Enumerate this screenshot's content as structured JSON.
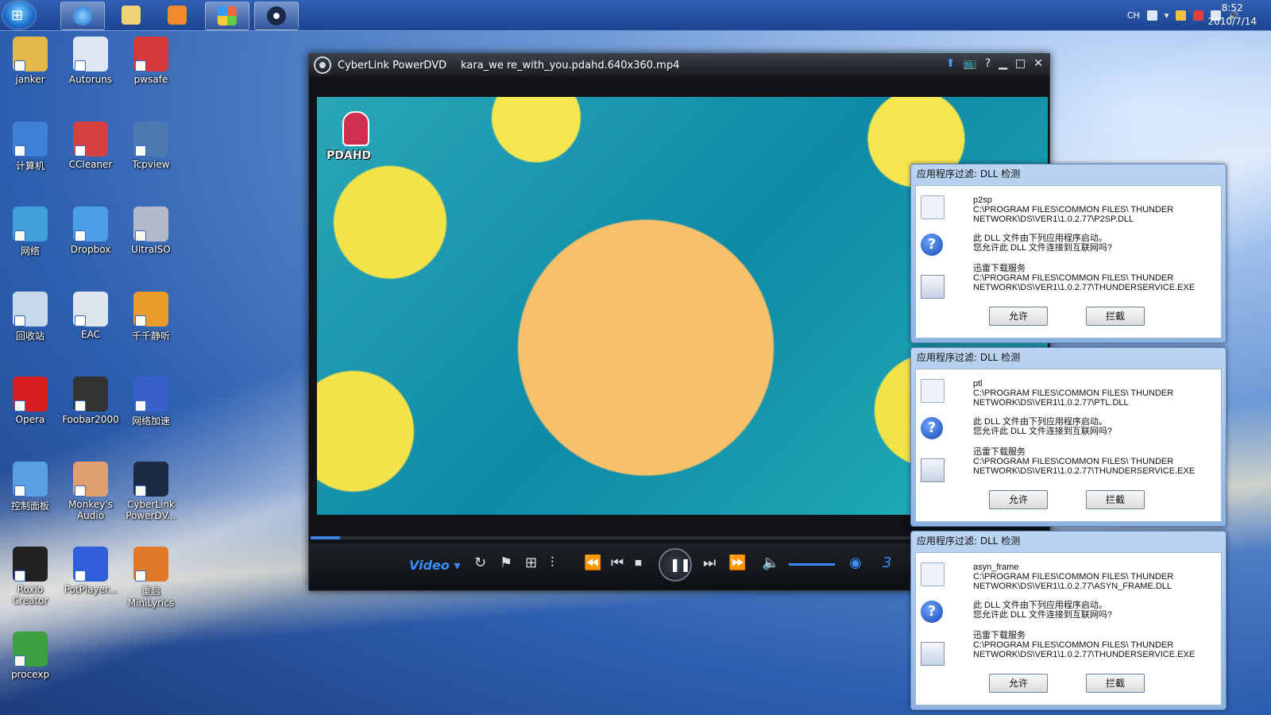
{
  "taskbar": {
    "apps": [
      "Internet Explorer",
      "Windows Explorer",
      "Media Player",
      "Windows Live",
      "CyberLink PowerDVD"
    ],
    "tray": {
      "lang": "CH"
    },
    "clock": {
      "time": "8:52",
      "date": "2010/7/14"
    }
  },
  "desktop": {
    "icons": [
      {
        "label": "janker",
        "color": "#e3b84a"
      },
      {
        "label": "Autoruns",
        "color": "#dfe6f2"
      },
      {
        "label": "pwsafe",
        "color": "#d63a3a"
      },
      {
        "label": "计算机",
        "color": "#3f7fd6"
      },
      {
        "label": "CCleaner",
        "color": "#d84040"
      },
      {
        "label": "Tcpview",
        "color": "#4c7ab0"
      },
      {
        "label": "网络",
        "color": "#3fa0d8"
      },
      {
        "label": "Dropbox",
        "color": "#4da0e8"
      },
      {
        "label": "UltraISO",
        "color": "#b3b9c8"
      },
      {
        "label": "回收站",
        "color": "#c8d8ea"
      },
      {
        "label": "EAC",
        "color": "#dfe5ee"
      },
      {
        "label": "千千静听",
        "color": "#e89a2a"
      },
      {
        "label": "Opera",
        "color": "#d81e1e"
      },
      {
        "label": "Foobar2000",
        "color": "#333333"
      },
      {
        "label": "网络加速",
        "color": "#3860c8"
      },
      {
        "label": "控制面板",
        "color": "#5aa0e0"
      },
      {
        "label": "Monkey's Audio",
        "color": "#e0a070"
      },
      {
        "label": "CyberLink PowerDV...",
        "color": "#1d2a45"
      },
      {
        "label": "Roxio Creator",
        "color": "#222222"
      },
      {
        "label": "PotPlayer...",
        "color": "#2f5ed8"
      },
      {
        "label": "重启 MiniLyrics",
        "color": "#e07a2a"
      },
      {
        "label": "procexp",
        "color": "#3ca040"
      }
    ]
  },
  "player": {
    "app_name": "CyberLink PowerDVD",
    "file_name": "kara_we re_with_you.pdahd.640x360.mp4",
    "watermark": "PDAHD",
    "mode_label": "Video",
    "seek_progress": 0.04,
    "volume_level": 0.6,
    "truncated_counter": "3"
  },
  "dialogs": [
    {
      "title": "应用程序过滤: DLL 检测",
      "dll_name": "p2sp",
      "dll_path_1": "C:\\PROGRAM FILES\\COMMON FILES\\ THUNDER",
      "dll_path_2": "NETWORK\\DS\\VER1\\1.0.2.77\\P2SP.DLL",
      "question_1": "此 DLL 文件由下列应用程序启动。",
      "question_2": "您允许此 DLL 文件连接到互联网吗?",
      "app_name": "迅雷下载服务",
      "app_path_1": "C:\\PROGRAM FILES\\COMMON FILES\\ THUNDER",
      "app_path_2": "NETWORK\\DS\\VER1\\1.0.2.77\\THUNDERSERVICE.EXE",
      "allow": "允许",
      "block": "拦截"
    },
    {
      "title": "应用程序过滤: DLL 检测",
      "dll_name": "ptl",
      "dll_path_1": "C:\\PROGRAM FILES\\COMMON FILES\\ THUNDER",
      "dll_path_2": "NETWORK\\DS\\VER1\\1.0.2.77\\PTL.DLL",
      "question_1": "此 DLL 文件由下列应用程序启动。",
      "question_2": "您允许此 DLL 文件连接到互联网吗?",
      "app_name": "迅雷下载服务",
      "app_path_1": "C:\\PROGRAM FILES\\COMMON FILES\\ THUNDER",
      "app_path_2": "NETWORK\\DS\\VER1\\1.0.2.77\\THUNDERSERVICE.EXE",
      "allow": "允许",
      "block": "拦截"
    },
    {
      "title": "应用程序过滤: DLL 检测",
      "dll_name": "asyn_frame",
      "dll_path_1": "C:\\PROGRAM FILES\\COMMON FILES\\ THUNDER",
      "dll_path_2": "NETWORK\\DS\\VER1\\1.0.2.77\\ASYN_FRAME.DLL",
      "question_1": "此 DLL 文件由下列应用程序启动。",
      "question_2": "您允许此 DLL 文件连接到互联网吗?",
      "app_name": "迅雷下载服务",
      "app_path_1": "C:\\PROGRAM FILES\\COMMON FILES\\ THUNDER",
      "app_path_2": "NETWORK\\DS\\VER1\\1.0.2.77\\THUNDERSERVICE.EXE",
      "allow": "允许",
      "block": "拦截"
    }
  ]
}
